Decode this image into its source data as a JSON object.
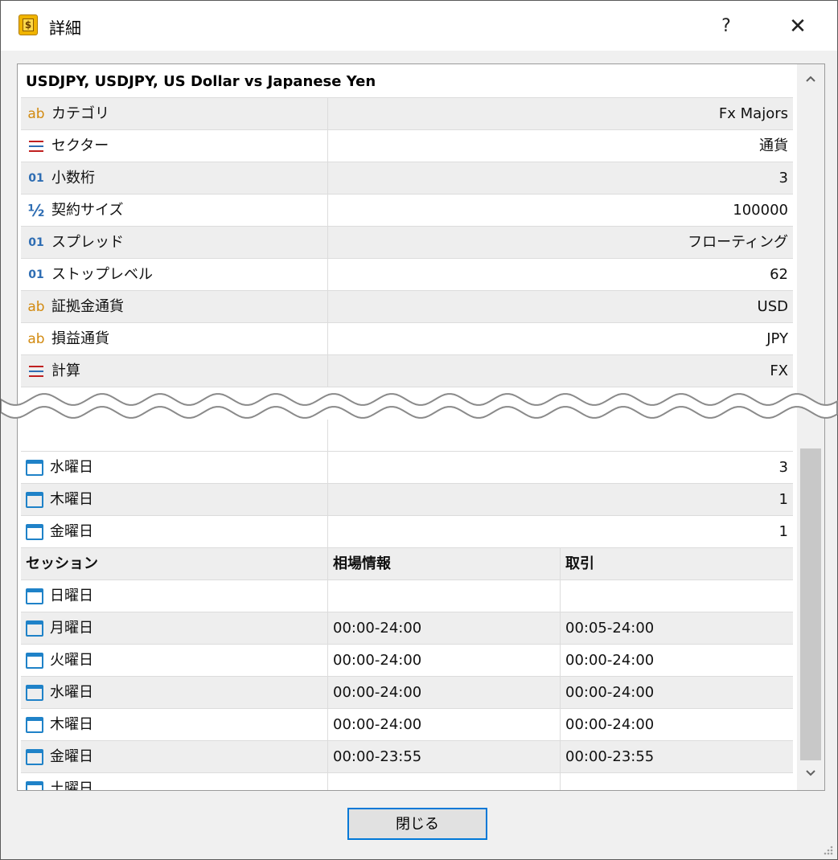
{
  "window": {
    "title": "詳細",
    "help_label": "?",
    "close_label": "✕",
    "icon": "symbol-dollar-icon"
  },
  "symbol_header": "USDJPY, USDJPY, US Dollar vs Japanese Yen",
  "properties": [
    {
      "icon": "ab",
      "label": "カテゴリ",
      "value": "Fx Majors"
    },
    {
      "icon": "list",
      "label": "セクター",
      "value": "通貨"
    },
    {
      "icon": "01",
      "label": "小数桁",
      "value": "3"
    },
    {
      "icon": "half",
      "label": "契約サイズ",
      "value": "100000"
    },
    {
      "icon": "01",
      "label": "スプレッド",
      "value": "フローティング"
    },
    {
      "icon": "01",
      "label": "ストップレベル",
      "value": "62"
    },
    {
      "icon": "ab",
      "label": "証拠金通貨",
      "value": "USD"
    },
    {
      "icon": "ab",
      "label": "損益通貨",
      "value": "JPY"
    },
    {
      "icon": "list",
      "label": "計算",
      "value": "FX"
    }
  ],
  "swap_days": [
    {
      "label": "水曜日",
      "value": "3"
    },
    {
      "label": "木曜日",
      "value": "1"
    },
    {
      "label": "金曜日",
      "value": "1"
    }
  ],
  "sessions": {
    "headers": [
      "セッション",
      "相場情報",
      "取引"
    ],
    "rows": [
      {
        "day": "日曜日",
        "quotes": "",
        "trade": ""
      },
      {
        "day": "月曜日",
        "quotes": "00:00-24:00",
        "trade": "00:05-24:00"
      },
      {
        "day": "火曜日",
        "quotes": "00:00-24:00",
        "trade": "00:00-24:00"
      },
      {
        "day": "水曜日",
        "quotes": "00:00-24:00",
        "trade": "00:00-24:00"
      },
      {
        "day": "木曜日",
        "quotes": "00:00-24:00",
        "trade": "00:00-24:00"
      },
      {
        "day": "金曜日",
        "quotes": "00:00-23:55",
        "trade": "00:00-23:55"
      },
      {
        "day": "土曜日",
        "quotes": "",
        "trade": ""
      }
    ]
  },
  "footer": {
    "close_button": "閉じる"
  },
  "colors": {
    "accent": "#0078d7",
    "icon_blue": "#1f82c8",
    "icon_ab": "#d28a10",
    "row_shade": "#eeeeee"
  }
}
